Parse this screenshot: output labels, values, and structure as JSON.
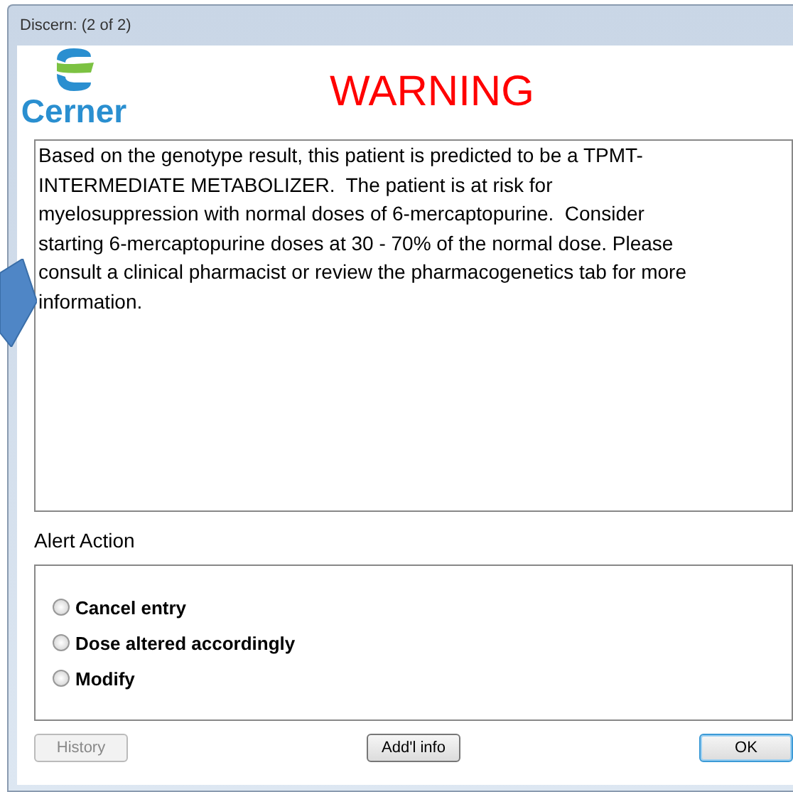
{
  "window": {
    "title": "Discern:  (2 of 2)"
  },
  "logo": {
    "text": "Cerner"
  },
  "heading": "WARNING",
  "message": "Based on the genotype result, this patient is predicted to be a TPMT-\nINTERMEDIATE METABOLIZER.  The patient is at risk for\nmyelosuppression with normal doses of 6-mercaptopurine.  Consider\nstarting 6-mercaptopurine doses at 30 - 70% of the normal dose. Please\nconsult a clinical pharmacist or review the pharmacogenetics tab for more\ninformation.",
  "alert_action": {
    "label": "Alert Action",
    "options": [
      {
        "label": "Cancel entry",
        "selected": false
      },
      {
        "label": "Dose altered accordingly",
        "selected": false
      },
      {
        "label": "Modify",
        "selected": false
      }
    ]
  },
  "buttons": [
    {
      "label": "History",
      "disabled": true,
      "default": false
    },
    {
      "label": "Add'l info",
      "disabled": false,
      "default": false
    },
    {
      "label": "OK",
      "disabled": false,
      "default": true
    }
  ]
}
